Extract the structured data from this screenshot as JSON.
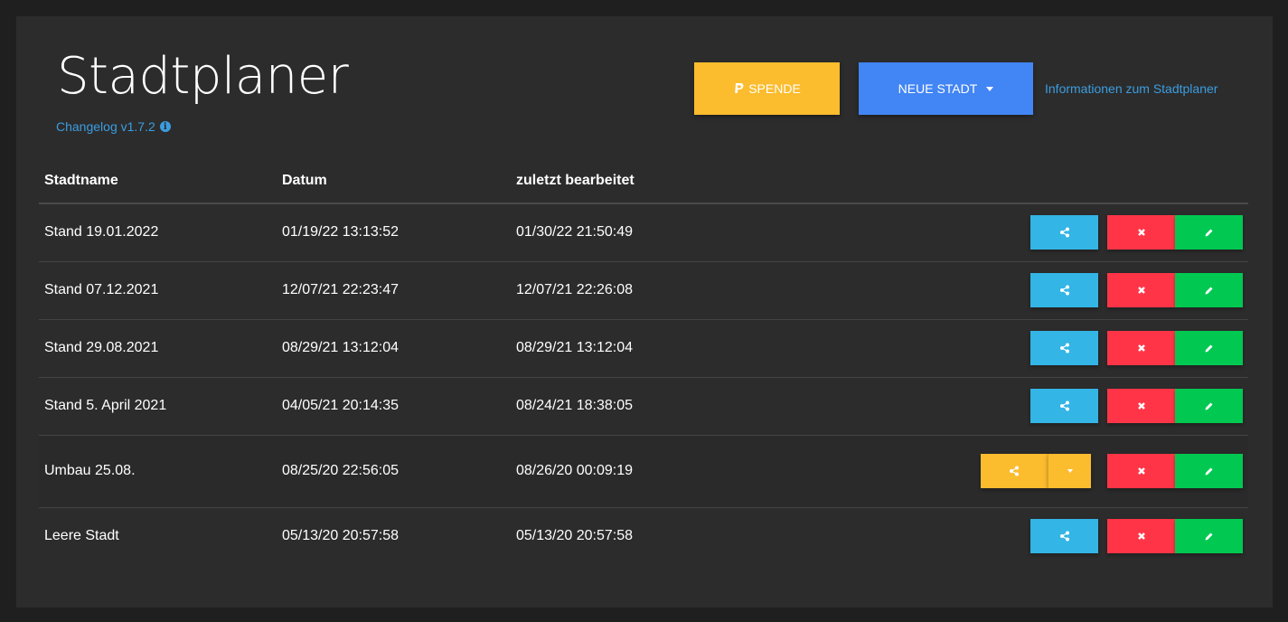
{
  "header": {
    "title": "Stadtplaner",
    "changelog": "Changelog v1.7.2",
    "donate_label": "SPENDE",
    "new_city_label": "NEUE STADT",
    "info_link": "Informationen zum Stadtplaner"
  },
  "table": {
    "columns": [
      "Stadtname",
      "Datum",
      "zuletzt bearbeitet"
    ],
    "rows": [
      {
        "name": "Stand 19.01.2022",
        "date": "01/19/22 13:13:52",
        "edited": "01/30/22 21:50:49"
      },
      {
        "name": "Stand 07.12.2021",
        "date": "12/07/21 22:23:47",
        "edited": "12/07/21 22:26:08"
      },
      {
        "name": "Stand 29.08.2021",
        "date": "08/29/21 13:12:04",
        "edited": "08/29/21 13:12:04"
      },
      {
        "name": "Stand 5. April 2021",
        "date": "04/05/21 20:14:35",
        "edited": "08/24/21 18:38:05"
      },
      {
        "name": "Umbau 25.08.",
        "date": "08/25/20 22:56:05",
        "edited": "08/26/20 00:09:19"
      },
      {
        "name": "Leere Stadt",
        "date": "05/13/20 20:57:58",
        "edited": "05/13/20 20:57:58"
      }
    ]
  },
  "colors": {
    "share": "#33b5e5",
    "delete": "#ff3547",
    "edit": "#00c851",
    "warning": "#fbbc2e",
    "primary": "#4285f4",
    "link": "#3b9de0"
  }
}
